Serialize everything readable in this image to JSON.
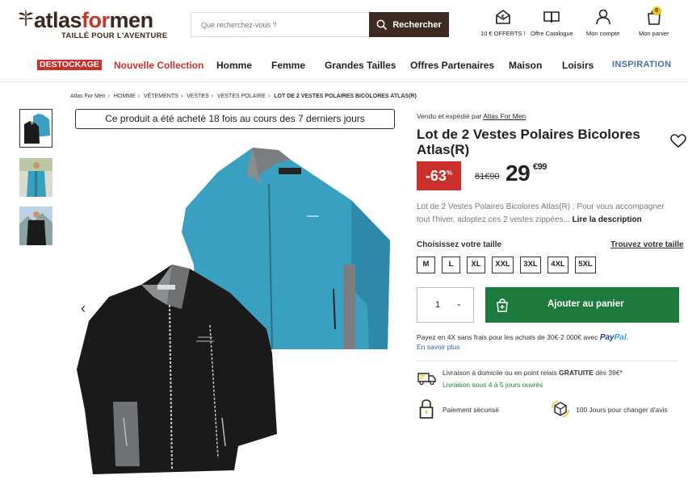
{
  "header": {
    "logo_brand_a": "atlas",
    "logo_brand_b": "for",
    "logo_brand_c": "men",
    "logo_tagline": "TAILLÉ POUR L'AVENTURE",
    "search_placeholder": "Que recherchez-vous ?",
    "search_button": "Rechercher",
    "icons": [
      {
        "label": "10 € OFFERTS !",
        "icon": "gift-envelope-icon"
      },
      {
        "label": "Offre Catalogue",
        "icon": "book-icon"
      },
      {
        "label": "Mon compte",
        "icon": "user-icon"
      },
      {
        "label": "Mon panier",
        "icon": "bag-icon"
      }
    ],
    "cart_count": "0"
  },
  "nav": {
    "items": [
      "DESTOCKAGE",
      "Nouvelle Collection",
      "Homme",
      "Femme",
      "Grandes Tailles",
      "Offres Partenaires",
      "Maison",
      "Loisirs",
      "INSPIRATION"
    ]
  },
  "breadcrumb": [
    "Atlas For Men",
    "HOMME",
    "VÊTEMENTS",
    "VESTES",
    "VESTES POLAIRE",
    "LOT DE 2 VESTES POLAIRES BICOLORES ATLAS(R)"
  ],
  "gallery": {
    "sold_banner": "Ce produit a été acheté 18 fois au cours des 7 derniers jours",
    "prev": "‹",
    "next": "›"
  },
  "product": {
    "seller_prefix": "Vendu et expédié par",
    "seller_name": "Atlas For Men",
    "title": "Lot de 2 Vestes Polaires Bicolores Atlas(R)",
    "discount": "-63",
    "discount_unit": "%",
    "old_price": "81€90",
    "price_int": "29",
    "price_cents": "€99",
    "description": "Lot de 2 Vestes Polaires Bicolores Atlas(R) : Pour vous accompagner tout l'hiver, adoptez ces 2 vestes zippées...",
    "read_more": "Lire la description",
    "size_label": "Choisissez votre taille",
    "size_guide": "Trouvez votre taille",
    "sizes": [
      "M",
      "L",
      "XL",
      "XXL",
      "3XL",
      "4XL",
      "5XL"
    ],
    "quantity": "1",
    "add_to_cart": "Ajouter au panier",
    "paypal_text": "Payez en 4X sans frais pour les achats de 30€-2 000€ avec",
    "paypal_brand_a": "Pay",
    "paypal_brand_b": "Pal",
    "paypal_dot": ".",
    "learn_more": "En savoir plus",
    "delivery_prefix": "Livraison à domicile ou en point relais",
    "delivery_bold": "GRATUITE",
    "delivery_suffix": "dès 39€*",
    "delivery_time": "Livraison sous 4 à 5 jours ouvrés",
    "secure_payment": "Paiement sécurisé",
    "returns": "100 Jours pour changer d'avis"
  },
  "colors": {
    "brand_dark": "#3d2a22",
    "accent_red": "#c9302c",
    "cart_green": "#1e7a3c",
    "jacket_blue": "#3aa0c0"
  }
}
